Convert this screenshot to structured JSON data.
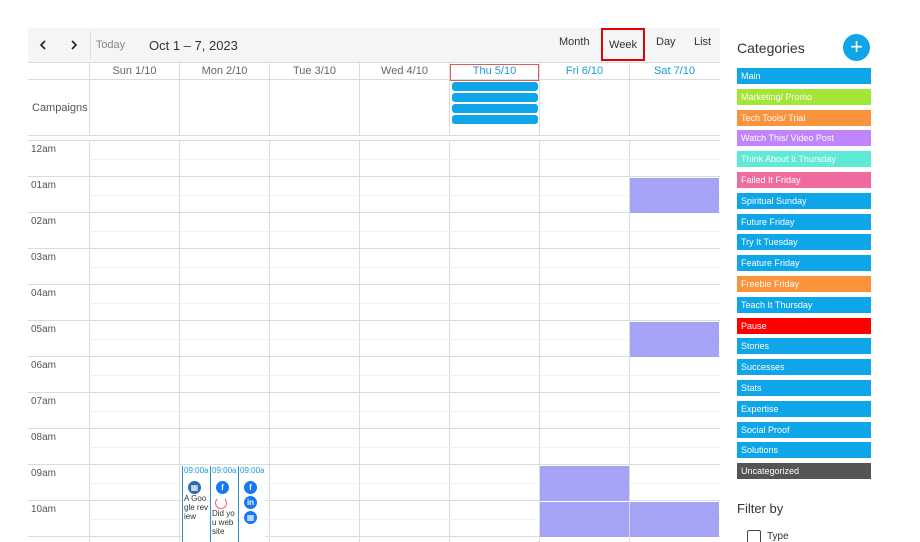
{
  "toolbar": {
    "prev_icon": "chevron-left-icon",
    "next_icon": "chevron-right-icon",
    "today_label": "Today",
    "date_range": "Oct 1 – 7, 2023",
    "views": {
      "month": "Month",
      "week": "Week",
      "day": "Day",
      "list": "List"
    },
    "active_view": "week"
  },
  "days": [
    {
      "label": "Sun 1/10",
      "is_today": false
    },
    {
      "label": "Mon 2/10",
      "is_today": false
    },
    {
      "label": "Tue 3/10",
      "is_today": false
    },
    {
      "label": "Wed 4/10",
      "is_today": false
    },
    {
      "label": "Thu 5/10",
      "is_today": true
    },
    {
      "label": "Fri 6/10",
      "is_today": false
    },
    {
      "label": "Sat 7/10",
      "is_today": false
    }
  ],
  "campaigns": {
    "label": "Campaigns",
    "bar_count": 4,
    "bar_color": "#0ea5e9",
    "day": "Thu 5/10"
  },
  "hours": [
    "12am",
    "01am",
    "02am",
    "03am",
    "04am",
    "05am",
    "06am",
    "07am",
    "08am",
    "09am",
    "10am"
  ],
  "events": [
    {
      "day": "Sat 7/10",
      "hour": "01am",
      "color": "#a5a3f6"
    },
    {
      "day": "Sat 7/10",
      "hour": "05am",
      "color": "#a5a3f6"
    },
    {
      "day": "Fri 6/10",
      "hour": "09am",
      "color": "#a5a3f6"
    },
    {
      "day": "Fri 6/10",
      "hour": "10am",
      "color": "#a5a3f6"
    },
    {
      "day": "Sat 7/10",
      "hour": "10am",
      "color": "#a5a3f6"
    }
  ],
  "posts": [
    {
      "time": "09:00a",
      "icon": "calendar-icon",
      "icon_color": "#2b6cb0",
      "text": "A Google review"
    },
    {
      "time": "09:00a",
      "icon": "facebook-icon",
      "icon_color": "#1877f2",
      "text": "Did you website"
    },
    {
      "time": "09:00a",
      "icon": "facebook-icon",
      "icon_color": "#1877f2",
      "icon2": "linkedin-icon",
      "icon3": "calendar-icon",
      "text": ""
    }
  ],
  "sidebar": {
    "title": "Categories",
    "add_icon": "plus-icon",
    "categories": [
      {
        "label": "Main",
        "color": "#0ea5e9"
      },
      {
        "label": "Marketing/ Promo",
        "color": "#a3e635"
      },
      {
        "label": "Tech Tools/ Trial",
        "color": "#fb923c"
      },
      {
        "label": "Watch This/ Video Post",
        "color": "#c084fc"
      },
      {
        "label": "Think About It Thursday",
        "color": "#5eead4"
      },
      {
        "label": "Failed It Friday",
        "color": "#f06aa0"
      },
      {
        "label": "Spiritual Sunday",
        "color": "#0ea5e9"
      },
      {
        "label": "Future Friday",
        "color": "#0ea5e9"
      },
      {
        "label": "Try It Tuesday",
        "color": "#0ea5e9"
      },
      {
        "label": "Feature Friday",
        "color": "#0ea5e9"
      },
      {
        "label": "Freebie Friday",
        "color": "#fb923c"
      },
      {
        "label": "Teach It Thursday",
        "color": "#0ea5e9"
      },
      {
        "label": "Pause",
        "color": "#ff0000"
      },
      {
        "label": "Stories",
        "color": "#0ea5e9"
      },
      {
        "label": "Successes",
        "color": "#0ea5e9"
      },
      {
        "label": "Stats",
        "color": "#0ea5e9"
      },
      {
        "label": "Expertise",
        "color": "#0ea5e9"
      },
      {
        "label": "Social Proof",
        "color": "#0ea5e9"
      },
      {
        "label": "Solutions",
        "color": "#0ea5e9"
      },
      {
        "label": "Uncategorized",
        "color": "#555555"
      }
    ],
    "filter_title": "Filter by",
    "filter_type_label": "Type"
  }
}
